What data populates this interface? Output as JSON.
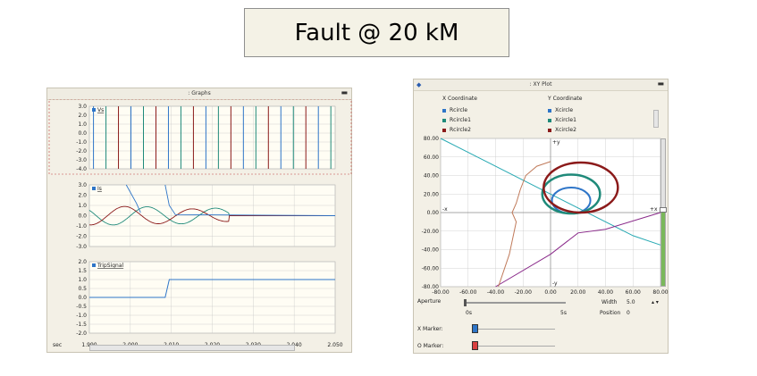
{
  "title": "Fault @ 20 kM",
  "graphs_panel": {
    "title": ": Graphs",
    "minimize": "▬",
    "x_axis_label": "sec",
    "x_ticks": [
      "1.990",
      "2.000",
      "2.010",
      "2.020",
      "2.030",
      "2.040",
      "2.050"
    ]
  },
  "xyplot_panel": {
    "title": ": XY Plot",
    "minimize": "▬",
    "pin": "◆",
    "x_coord_header": "X Coordinate",
    "y_coord_header": "Y Coordinate",
    "x_coord_items": [
      {
        "label": "Rcircle",
        "color": "#2e75c8"
      },
      {
        "label": "Rcircle1",
        "color": "#1f8a7a"
      },
      {
        "label": "Rcircle2",
        "color": "#8b1a1a"
      }
    ],
    "y_coord_items": [
      {
        "label": "Xcircle",
        "color": "#2e75c8"
      },
      {
        "label": "Xcircle1",
        "color": "#1f8a7a"
      },
      {
        "label": "Xcircle2",
        "color": "#8b1a1a"
      }
    ],
    "axis_labels": {
      "plus_y": "+y",
      "minus_y": "-y",
      "minus_x": "-x",
      "plus_x": "+x"
    },
    "aperture_label": "Aperture",
    "width_label": "Width",
    "width_value": "5.0",
    "position_label": "Position",
    "position_value": "0",
    "aperture_min": "0s",
    "aperture_max": "5s",
    "x_marker_label": "X Marker:",
    "o_marker_label": "O Marker:"
  },
  "colors": {
    "blue": "#2e75c8",
    "teal": "#1f8a7a",
    "dark_red": "#8b1a1a",
    "cyan": "#27a9b3",
    "purple": "#8a2a8a",
    "brown": "#c07a5a",
    "grid": "#c8c8c8",
    "plot_bg": "#ffffff"
  },
  "chart_data": [
    {
      "type": "line",
      "legend": [
        "Vs"
      ],
      "ylim": [
        -4.0,
        3.0
      ],
      "y_ticks": [
        "3.0",
        "2.0",
        "1.0",
        "0.0",
        "-1.0",
        "-2.0",
        "-3.0",
        "-4.0"
      ],
      "xlim": [
        1.99,
        2.05
      ],
      "series": [
        {
          "name": "Vs",
          "values": "phase voltages sampled as vertical pulses (blue, teal, dark red)"
        }
      ]
    },
    {
      "type": "line",
      "legend": [
        "Is"
      ],
      "ylim": [
        -3.0,
        3.0
      ],
      "y_ticks": [
        "3.0",
        "2.0",
        "1.0",
        "0.0",
        "-1.0",
        "-2.0",
        "-3.0"
      ],
      "xlim": [
        1.99,
        2.05
      ],
      "series": [
        {
          "name": "Is"
        }
      ]
    },
    {
      "type": "line",
      "legend": [
        "TripSignal"
      ],
      "ylim": [
        -2.0,
        2.0
      ],
      "y_ticks": [
        "2.0",
        "1.5",
        "1.0",
        "0.5",
        "0.0",
        "-0.5",
        "-1.0",
        "-1.5",
        "-2.0"
      ],
      "xlim": [
        1.99,
        2.05
      ],
      "series": [
        {
          "name": "TripSignal",
          "x": [
            1.99,
            2.0085,
            2.0095,
            2.05
          ],
          "values": [
            0.0,
            0.0,
            1.0,
            1.0
          ]
        }
      ]
    },
    {
      "type": "line",
      "xlim": [
        -80,
        80
      ],
      "ylim": [
        -80,
        80
      ],
      "x_ticks": [
        "-80.00",
        "-60.00",
        "-40.00",
        "-20.00",
        "0.00",
        "20.00",
        "40.00",
        "60.00",
        "80.00"
      ],
      "y_ticks": [
        "80.00",
        "60.00",
        "40.00",
        "20.00",
        "0.00",
        "-20.00",
        "-40.00",
        "-60.00",
        "-80.00"
      ],
      "series": [
        {
          "name": "Rcircle",
          "center": [
            15,
            13
          ],
          "radius": 14
        },
        {
          "name": "Rcircle1",
          "center": [
            15,
            20
          ],
          "radius": 21
        },
        {
          "name": "Rcircle2",
          "center": [
            22,
            27
          ],
          "radius": 27
        },
        {
          "name": "cyan-line",
          "x": [
            -80,
            0,
            60,
            80
          ],
          "values": [
            80,
            20,
            -25,
            -35
          ]
        },
        {
          "name": "purple-line",
          "x": [
            -40,
            0,
            20,
            40,
            80
          ],
          "values": [
            -80,
            -45,
            -22,
            -18,
            0
          ]
        },
        {
          "name": "brown-line",
          "x": [
            -38,
            -30,
            -25,
            -28,
            -25,
            -22,
            -18,
            -10,
            0
          ],
          "values": [
            -80,
            -45,
            -10,
            0,
            10,
            25,
            40,
            50,
            55
          ]
        }
      ]
    }
  ]
}
